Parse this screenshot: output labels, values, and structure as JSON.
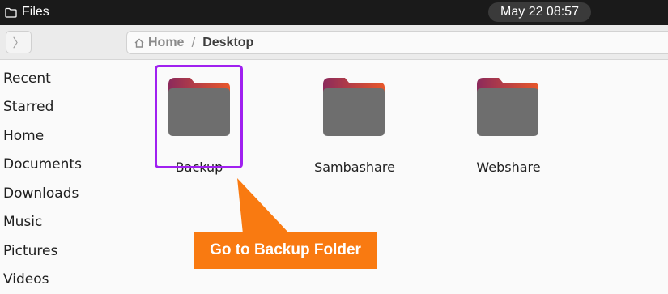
{
  "topbar": {
    "app_name": "Files",
    "clock": "May 22  08:57"
  },
  "header": {
    "breadcrumb": [
      "Home",
      "Desktop"
    ],
    "separator": "/"
  },
  "sidebar": {
    "items": [
      {
        "label": "Recent"
      },
      {
        "label": "Starred"
      },
      {
        "label": "Home"
      },
      {
        "label": "Documents"
      },
      {
        "label": "Downloads"
      },
      {
        "label": "Music"
      },
      {
        "label": "Pictures"
      },
      {
        "label": "Videos"
      }
    ]
  },
  "folders": [
    {
      "name": "Backup",
      "highlighted": true
    },
    {
      "name": "Sambashare"
    },
    {
      "name": "Webshare"
    }
  ],
  "annotation": {
    "text": "Go to Backup Folder",
    "highlight_color": "#a020f0",
    "callout_color": "#f97a11"
  },
  "icons": {
    "app": "folder-icon",
    "forward": "chevron-right-icon",
    "home": "home-icon"
  }
}
